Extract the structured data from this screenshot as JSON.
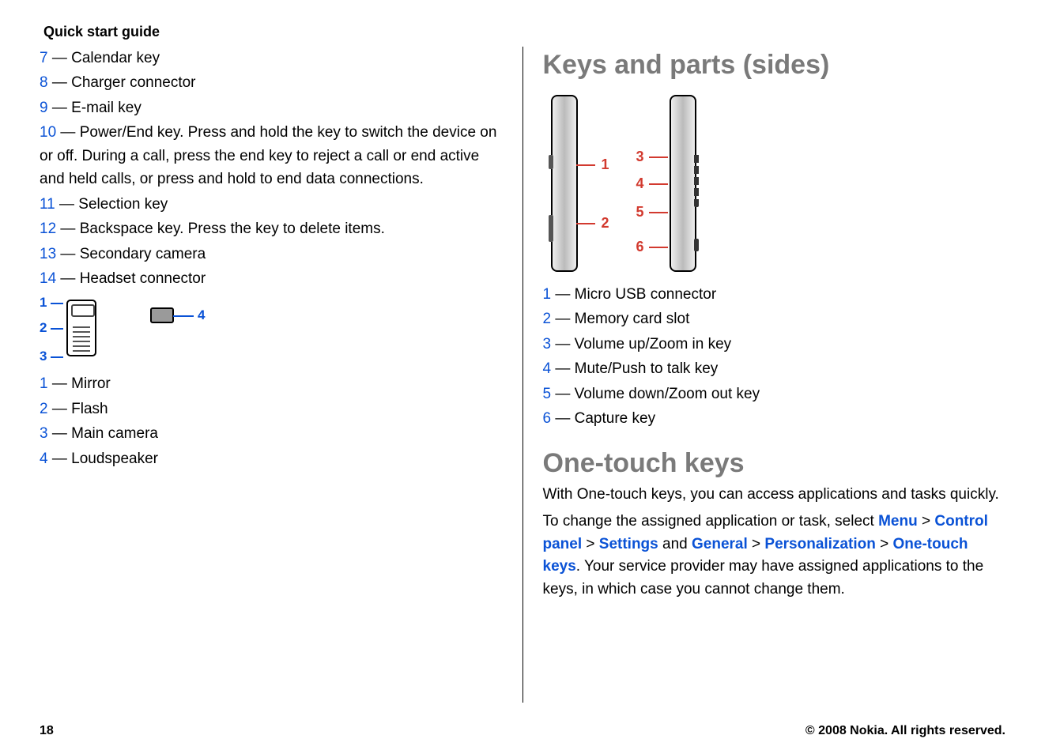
{
  "header": {
    "section_title": "Quick start guide"
  },
  "left": {
    "list_a": [
      {
        "n": "7",
        "t": "Calendar key"
      },
      {
        "n": "8",
        "t": "Charger connector"
      },
      {
        "n": "9",
        "t": "E-mail key"
      },
      {
        "n": "10",
        "t": "Power/End key. Press and hold the key to switch the device on or off. During a call, press the end key to reject a call or end active and held calls, or press and hold to end data connections."
      },
      {
        "n": "11",
        "t": "Selection key"
      },
      {
        "n": "12",
        "t": "Backspace key. Press the key to delete items."
      },
      {
        "n": "13",
        "t": "Secondary camera"
      },
      {
        "n": "14",
        "t": "Headset connector"
      }
    ],
    "fig1_labels": {
      "1": "1",
      "2": "2",
      "3": "3",
      "4": "4"
    },
    "list_b": [
      {
        "n": "1",
        "t": "Mirror"
      },
      {
        "n": "2",
        "t": "Flash"
      },
      {
        "n": "3",
        "t": "Main camera"
      },
      {
        "n": "4",
        "t": "Loudspeaker"
      }
    ]
  },
  "right": {
    "heading_a": "Keys and parts (sides)",
    "fig2_labels": {
      "1": "1",
      "2": "2",
      "3": "3",
      "4": "4",
      "5": "5",
      "6": "6"
    },
    "list_c": [
      {
        "n": "1",
        "t": "Micro USB connector"
      },
      {
        "n": "2",
        "t": "Memory card slot"
      },
      {
        "n": "3",
        "t": "Volume up/Zoom in key"
      },
      {
        "n": "4",
        "t": "Mute/Push to talk key"
      },
      {
        "n": "5",
        "t": "Volume down/Zoom out key"
      },
      {
        "n": "6",
        "t": "Capture key"
      }
    ],
    "heading_b": "One-touch keys",
    "para1": "With One-touch keys, you can access applications and tasks quickly.",
    "para2_a": "To change the assigned application or task, select ",
    "menu": "Menu",
    "gt1": " > ",
    "control_panel": "Control panel",
    "gt2": " > ",
    "settings": "Settings",
    "and": " and ",
    "general": "General",
    "gt3": " > ",
    "personalization": "Personalization",
    "gt4": " > ",
    "otk": "One-touch keys",
    "para2_b": ". Your service provider may have assigned applications to the keys, in which case you cannot change them."
  },
  "footer": {
    "page": "18",
    "copyright": "© 2008 Nokia. All rights reserved."
  }
}
